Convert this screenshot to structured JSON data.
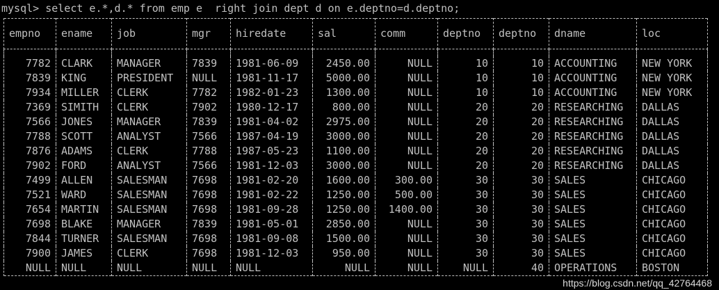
{
  "terminal": {
    "prompt": "mysql>",
    "command": " select e.*,d.* from emp e  right join dept d on e.deptno=d.deptno;"
  },
  "table": {
    "columns": [
      "empno",
      "ename",
      "job",
      "mgr",
      "hiredate",
      "sal",
      "comm",
      "deptno",
      "deptno",
      "dname",
      "loc"
    ],
    "rows": [
      [
        "7782",
        "CLARK",
        "MANAGER",
        "7839",
        "1981-06-09",
        "2450.00",
        "NULL",
        "10",
        "10",
        "ACCOUNTING",
        "NEW YORK"
      ],
      [
        "7839",
        "KING",
        "PRESIDENT",
        "NULL",
        "1981-11-17",
        "5000.00",
        "NULL",
        "10",
        "10",
        "ACCOUNTING",
        "NEW YORK"
      ],
      [
        "7934",
        "MILLER",
        "CLERK",
        "7782",
        "1982-01-23",
        "1300.00",
        "NULL",
        "10",
        "10",
        "ACCOUNTING",
        "NEW YORK"
      ],
      [
        "7369",
        "SIMITH",
        "CLERK",
        "7902",
        "1980-12-17",
        "800.00",
        "NULL",
        "20",
        "20",
        "RESEARCHING",
        "DALLAS"
      ],
      [
        "7566",
        "JONES",
        "MANAGER",
        "7839",
        "1981-04-02",
        "2975.00",
        "NULL",
        "20",
        "20",
        "RESEARCHING",
        "DALLAS"
      ],
      [
        "7788",
        "SCOTT",
        "ANALYST",
        "7566",
        "1987-04-19",
        "3000.00",
        "NULL",
        "20",
        "20",
        "RESEARCHING",
        "DALLAS"
      ],
      [
        "7876",
        "ADAMS",
        "CLERK",
        "7788",
        "1987-05-23",
        "1100.00",
        "NULL",
        "20",
        "20",
        "RESEARCHING",
        "DALLAS"
      ],
      [
        "7902",
        "FORD",
        "ANALYST",
        "7566",
        "1981-12-03",
        "3000.00",
        "NULL",
        "20",
        "20",
        "RESEARCHING",
        "DALLAS"
      ],
      [
        "7499",
        "ALLEN",
        "SALESMAN",
        "7698",
        "1981-02-20",
        "1600.00",
        "300.00",
        "30",
        "30",
        "SALES",
        "CHICAGO"
      ],
      [
        "7521",
        "WARD",
        "SALESMAN",
        "7698",
        "1981-02-22",
        "1250.00",
        "500.00",
        "30",
        "30",
        "SALES",
        "CHICAGO"
      ],
      [
        "7654",
        "MARTIN",
        "SALESMAN",
        "7698",
        "1981-09-28",
        "1250.00",
        "1400.00",
        "30",
        "30",
        "SALES",
        "CHICAGO"
      ],
      [
        "7698",
        "BLAKE",
        "MANAGER",
        "7839",
        "1981-05-01",
        "2850.00",
        "NULL",
        "30",
        "30",
        "SALES",
        "CHICAGO"
      ],
      [
        "7844",
        "TURNER",
        "SALESMAN",
        "7698",
        "1981-09-08",
        "1500.00",
        "NULL",
        "30",
        "30",
        "SALES",
        "CHICAGO"
      ],
      [
        "7900",
        "JAMES",
        "CLERK",
        "7698",
        "1981-12-03",
        "950.00",
        "NULL",
        "30",
        "30",
        "SALES",
        "CHICAGO"
      ],
      [
        "NULL",
        "NULL",
        "NULL",
        "NULL",
        "NULL",
        "NULL",
        "NULL",
        "NULL",
        "40",
        "OPERATIONS",
        "BOSTON"
      ]
    ]
  },
  "watermark": "https://blog.csdn.net/qq_42764468",
  "colors": {
    "background": "#000000",
    "text": "#c0c0c0"
  }
}
